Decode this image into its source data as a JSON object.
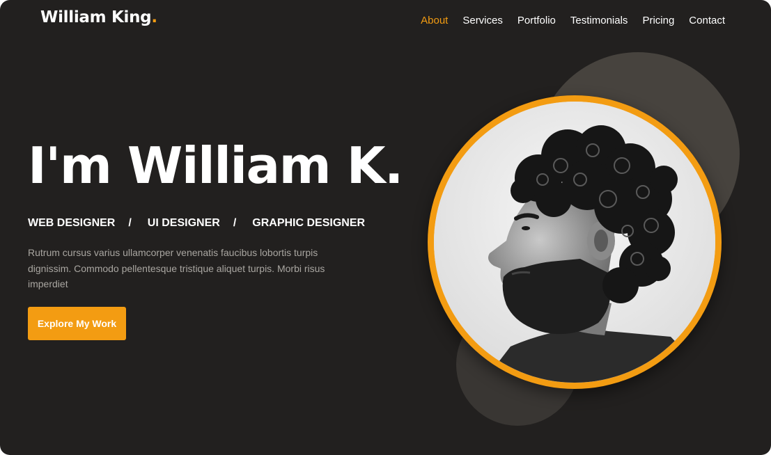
{
  "brand": {
    "name": "William King",
    "dot": ".",
    "accent_color": "#f39c12"
  },
  "nav": {
    "items": [
      {
        "label": "About",
        "active": true
      },
      {
        "label": "Services",
        "active": false
      },
      {
        "label": "Portfolio",
        "active": false
      },
      {
        "label": "Testimonials",
        "active": false
      },
      {
        "label": "Pricing",
        "active": false
      },
      {
        "label": "Contact",
        "active": false
      }
    ]
  },
  "hero": {
    "title": "I'm William K.",
    "roles": [
      "WEB DESIGNER",
      "UI DESIGNER",
      "GRAPHIC DESIGNER"
    ],
    "separator": "/",
    "description": "Rutrum cursus varius ullamcorper venenatis faucibus lobortis turpis dignissim. Commodo pellentesque tristique aliquet turpis. Morbi risus imperdiet",
    "cta_label": "Explore My Work"
  },
  "colors": {
    "background": "#22201f",
    "text": "#ffffff",
    "muted_text": "#a9a6a1",
    "accent": "#f39c12"
  }
}
